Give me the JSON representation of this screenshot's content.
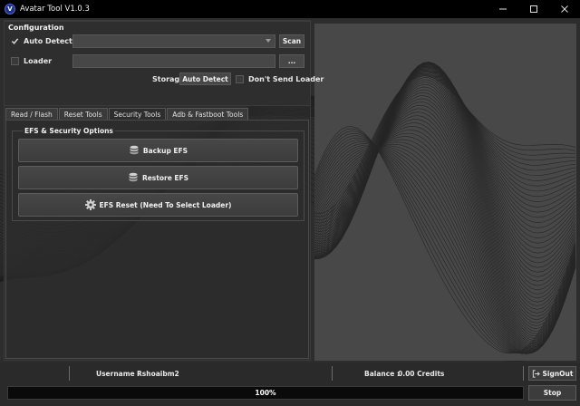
{
  "window": {
    "title": "Avatar Tool V1.0.3",
    "logo_letter": "V"
  },
  "config": {
    "section_title": "Configuration",
    "auto_detect_label": "Auto Detect",
    "auto_detect_checked": true,
    "port_value": "",
    "scan_label": "Scan",
    "loader_label": "Loader",
    "loader_checked": false,
    "loader_path": "",
    "browse_label": "...",
    "storage_label": "Storage",
    "storage_value": "Auto Detect",
    "dont_send_loader_label": "Don't Send Loader",
    "dont_send_loader_checked": false
  },
  "tabs": [
    {
      "label": "Read / Flash",
      "active": false
    },
    {
      "label": "Reset Tools",
      "active": false
    },
    {
      "label": "Security Tools",
      "active": true
    },
    {
      "label": "Adb & Fastboot Tools",
      "active": false
    }
  ],
  "security": {
    "group_title": "EFS & Security Options",
    "backup_label": "Backup EFS",
    "restore_label": "Restore EFS",
    "reset_label": "EFS Reset (Need To Select Loader)"
  },
  "status": {
    "username_label": "Username :",
    "username_value": "Rshoaibm2",
    "balance_label": "Balance :",
    "balance_value": "0.00 Credits",
    "signout_label": "SignOut",
    "progress_text": "100%",
    "progress_value": 100,
    "stop_label": "Stop"
  },
  "icons": {
    "logo": "app-logo-icon",
    "minimize": "minimize-icon",
    "maximize": "maximize-icon",
    "close": "close-icon",
    "check": "checkmark-icon",
    "dropdown": "chevron-down-icon",
    "database": "database-icon",
    "gear": "gear-icon",
    "signout": "signout-icon"
  },
  "colors": {
    "titlebar": "#000000",
    "background": "#2d2d2d",
    "logo_blue": "#1c2f8a"
  }
}
